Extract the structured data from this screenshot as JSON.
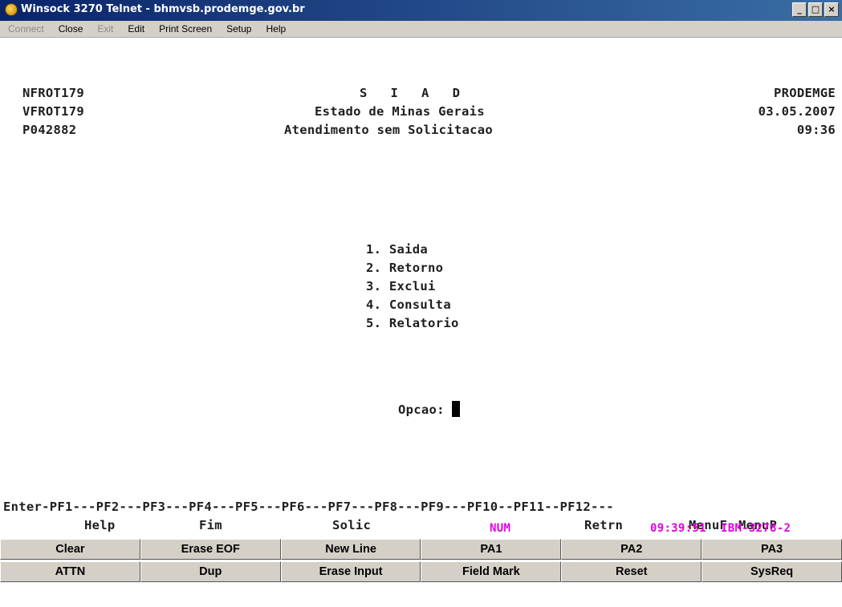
{
  "window": {
    "title": "Winsock 3270 Telnet - bhmvsb.prodemge.gov.br",
    "minimize": "_",
    "maximize": "□",
    "close": "×"
  },
  "menu": [
    {
      "label": "Connect",
      "enabled": false
    },
    {
      "label": "Close",
      "enabled": true
    },
    {
      "label": "Exit",
      "enabled": false
    },
    {
      "label": "Edit",
      "enabled": true
    },
    {
      "label": "Print Screen",
      "enabled": true
    },
    {
      "label": "Setup",
      "enabled": true
    },
    {
      "label": "Help",
      "enabled": true
    }
  ],
  "screen": {
    "header_left": [
      "NFROT179",
      "VFROT179",
      "P042882"
    ],
    "header_center": [
      "S   I   A   D",
      "Estado de Minas Gerais",
      "Atendimento sem Solicitacao"
    ],
    "header_right": [
      "PRODEMGE",
      "03.05.2007",
      "09:36"
    ],
    "options": [
      "1. Saida",
      "2. Retorno",
      "3. Exclui",
      "4. Consulta",
      "5. Relatorio"
    ],
    "prompt_label": "Opcao:",
    "pf_keys_line": "Enter-PF1---PF2---PF3---PF4---PF5---PF6---PF7---PF8---PF9---PF10--PF11--PF12---",
    "pf_labels": {
      "help": "Help",
      "fim": "Fim",
      "solic": "Solic",
      "retrn": "Retrn",
      "menuf": "MenuF",
      "menup": "MenuP"
    },
    "status": {
      "num": "NUM",
      "time": "09:39:51",
      "terminal": "IBM-3278-2"
    }
  },
  "buttons_row1": [
    "Clear",
    "Erase EOF",
    "New Line",
    "PA1",
    "PA2",
    "PA3"
  ],
  "buttons_row2": [
    "ATTN",
    "Dup",
    "Erase Input",
    "Field Mark",
    "Reset",
    "SysReq"
  ],
  "colors": {
    "status_pink": "#e000e0",
    "titlebar_start": "#0a246a",
    "titlebar_end": "#3a6ea5",
    "chrome": "#d4d0c8"
  }
}
